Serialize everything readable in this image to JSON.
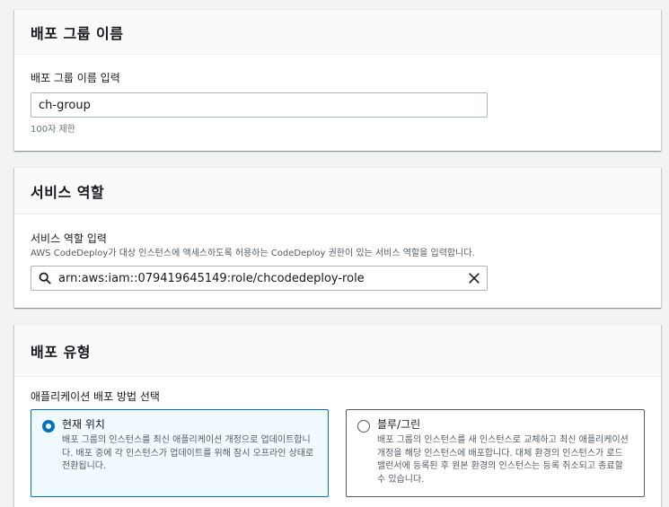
{
  "group_name_section": {
    "title": "배포 그룹 이름",
    "field_label": "배포 그룹 이름 입력",
    "value": "ch-group",
    "constraint": "100자 제한"
  },
  "service_role_section": {
    "title": "서비스 역할",
    "field_label": "서비스 역할 입력",
    "description": "AWS CodeDeploy가 대상 인스턴스에 액세스하도록 허용하는 CodeDeploy 권한이 있는 서비스 역할을 입력합니다.",
    "value": "arn:aws:iam::079419645149:role/chcodedeploy-role",
    "search_icon": "search-icon",
    "clear_icon": "close-icon"
  },
  "deployment_type_section": {
    "title": "배포 유형",
    "field_label": "애플리케이션 배포 방법 선택",
    "options": [
      {
        "label": "현재 위치",
        "description": "배포 그룹의 인스턴스를 최신 애플리케이션 개정으로 업데이트합니다. 배포 중에 각 인스턴스가 업데이트를 위해 잠시 오프라인 상태로 전환됩니다.",
        "selected": true
      },
      {
        "label": "블루/그린",
        "description": "배포 그룹의 인스턴스를 새 인스턴스로 교체하고 최신 애플리케이션 개정을 해당 인스턴스에 배포합니다. 대체 환경의 인스턴스가 로드 밸런서에 등록된 후 원본 환경의 인스턴스는 등록 취소되고 종료할 수 있습니다.",
        "selected": false
      }
    ]
  },
  "colors": {
    "accent": "#0073bb",
    "page_bg": "#f2f3f3",
    "header_bg": "#fafafa"
  }
}
